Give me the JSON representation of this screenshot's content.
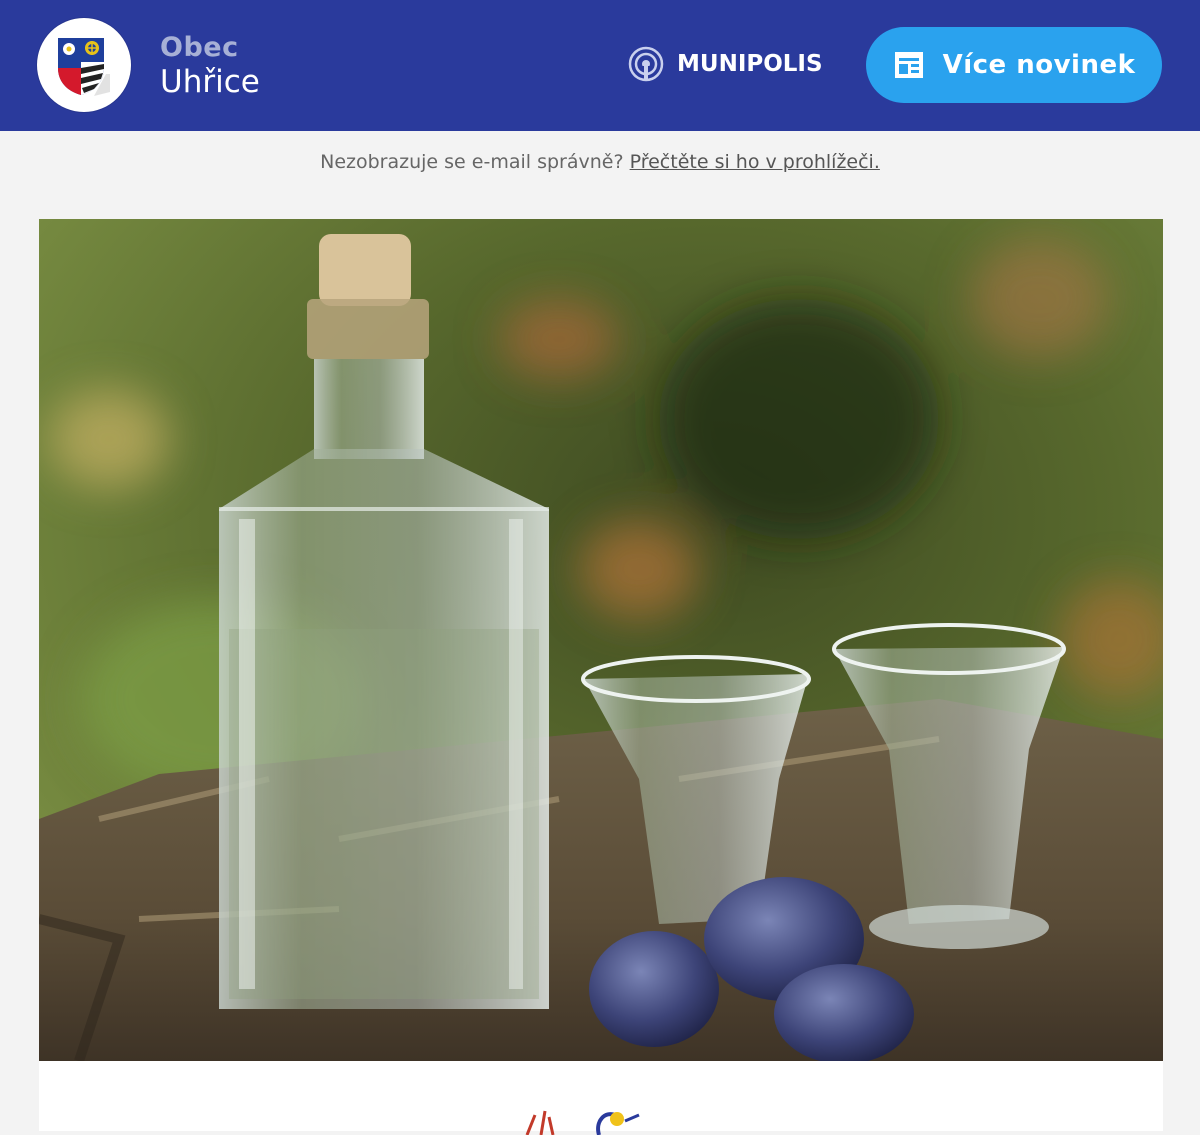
{
  "header": {
    "town_label": "Obec",
    "town_name": "Uhřice",
    "logo_icon": "coat-of-arms-icon",
    "munipolis_label": "MUNIPOLIS",
    "munipolis_icon": "broadcast-icon",
    "more_news_label": "Více novinek",
    "more_news_icon": "newspaper-icon"
  },
  "notice": {
    "text": "Nezobrazuje se e-mail správně?",
    "link_label": "Přečtěte si ho v prohlížeči."
  },
  "colors": {
    "header_bg": "#2a3a9c",
    "button_bg": "#2aa2ee",
    "page_bg": "#f3f3f3"
  }
}
